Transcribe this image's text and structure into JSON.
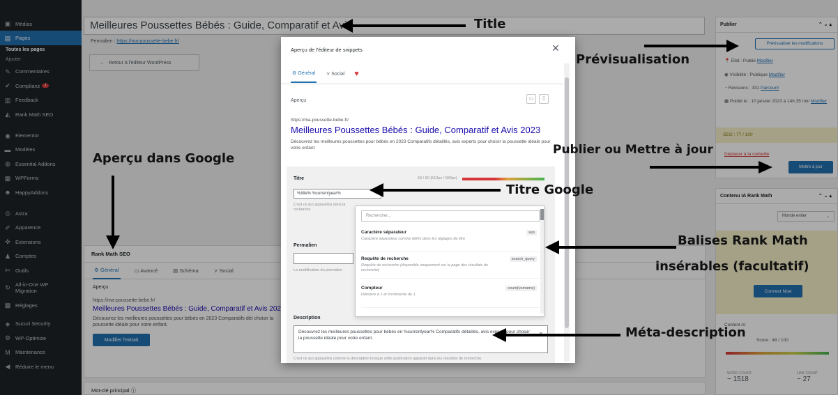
{
  "sidebar": {
    "items": [
      {
        "label": "Médias",
        "icon": "media-icon"
      },
      {
        "label": "Pages",
        "icon": "pages-icon"
      },
      {
        "label": "Toutes les pages"
      },
      {
        "label": "Ajouter"
      },
      {
        "label": "Commentaires",
        "icon": "comments-icon"
      },
      {
        "label": "Complianz",
        "icon": "complianz-icon",
        "badge": "1"
      },
      {
        "label": "Feedback",
        "icon": "feedback-icon"
      },
      {
        "label": "Rank Math SEO",
        "icon": "rankmath-icon"
      },
      {
        "label": "Elementor",
        "icon": "elementor-icon"
      },
      {
        "label": "Modèles",
        "icon": "templates-icon"
      },
      {
        "label": "Essential Addons",
        "icon": "addons-icon"
      },
      {
        "label": "WPForms",
        "icon": "wpforms-icon"
      },
      {
        "label": "HappyAddons",
        "icon": "happyaddons-icon"
      },
      {
        "label": "Astra",
        "icon": "astra-icon"
      },
      {
        "label": "Apparence",
        "icon": "appearance-icon"
      },
      {
        "label": "Extensions",
        "icon": "plugins-icon"
      },
      {
        "label": "Comptes",
        "icon": "users-icon"
      },
      {
        "label": "Outils",
        "icon": "tools-icon"
      },
      {
        "label": "All-in-One WP Migration",
        "icon": "migration-icon"
      },
      {
        "label": "Réglages",
        "icon": "settings-icon"
      },
      {
        "label": "Sucuri Security",
        "icon": "sucuri-icon"
      },
      {
        "label": "WP-Optimize",
        "icon": "optimize-icon"
      },
      {
        "label": "Maintenance",
        "icon": "maintenance-icon"
      },
      {
        "label": "Réduire le menu",
        "icon": "collapse-icon"
      }
    ]
  },
  "editor": {
    "title": "Meilleures Poussettes Bébés : Guide, Comparatif et Avis",
    "permalink_label": "Permalien :",
    "permalink_url": "https://ma-poussette-bebe.fr/",
    "back_button": "Retour à l'éditeur WordPress"
  },
  "rank_math_panel": {
    "title": "Rank Math SEO",
    "tabs": [
      "Général",
      "Avancé",
      "Schéma",
      "Social"
    ],
    "preview_label": "Aperçu",
    "url": "https://ma-poussette-bebe.fr/",
    "google_title": "Meilleures Poussettes Bébés : Guide, Comparatif et Avis 202",
    "google_desc": "Découvrez les meilleures poussettes pour bébés en 2023 Comparatifs dét choisir la poussette idéale pour votre enfant.",
    "edit_button": "Modifier l'extrait",
    "focus_keyword": "Mot-clé principal"
  },
  "publish_box": {
    "title": "Publier",
    "preview_button": "Prévisualiser les modifications",
    "status_label": "État :",
    "status_value": "Publié",
    "status_link": "Modifier",
    "visibility_label": "Visibilité :",
    "visibility_value": "Publique",
    "visibility_link": "Modifier",
    "revisions_label": "Révisions :",
    "revisions_value": "331",
    "revisions_link": "Parcourir",
    "published_label": "Publié le :",
    "published_value": "10 janvier 2023 à 14h 35 min",
    "published_link": "Modifier",
    "seo_score": "SEO : 77 / 100",
    "trash_link": "Déplacer à la corbeille",
    "update_button": "Mettre à jour"
  },
  "rm_content_box": {
    "title": "Contenu IA Rank Math",
    "select": "Monde entier",
    "connect_button": "Connect Now",
    "content_ai_label": "Content AI",
    "score": "Score : 48 / 100",
    "word_count_label": "WORD COUNT",
    "word_count": "~ 1518",
    "link_count_label": "LINK COUNT",
    "link_count": "~ 27"
  },
  "modal": {
    "title": "Aperçu de l'éditeur de snippets",
    "close": "×",
    "tabs": [
      "Général",
      "Social"
    ],
    "preview_label": "Aperçu",
    "url": "https://ma-poussette-bebe.fr/",
    "google_title": "Meilleures Poussettes Bébés : Guide, Comparatif et Avis 2023",
    "google_desc": "Découvrez les meilleures poussettes pour bébés en 2023 Comparatifs détaillés, avis experts pour choisir la poussette idéale pour votre enfant",
    "title_label": "Titre",
    "title_count": "60 / 60 (512px / 580px)",
    "title_value": "%title% %currentyear%",
    "title_help": "C'est ce qui apparaîtra dans la recherche",
    "permalink_label": "Permalien",
    "permalink_help": "La modification du permalien",
    "description_label": "Description",
    "description_value": "Découvrez les meilleures poussettes pour bébés en %currentyear% Comparatifs détaillés, avis experts pour choisir la poussette idéale pour votre enfant.",
    "description_help": "C'est ce qui apparaîtra comme la description lorsque cette publication apparaît dans les résultats de recherche."
  },
  "dropdown": {
    "search_placeholder": "Rechercher...",
    "items": [
      {
        "name": "Caractère séparateur",
        "key": "sep",
        "desc": "Caractère séparateur comme défini dans les réglages de titre"
      },
      {
        "name": "Requête de recherche",
        "key": "search_query",
        "desc": "Requête de recherche (disponible uniquement sur la page des résultats de recherche)"
      },
      {
        "name": "Compteur",
        "key": "count(varname)",
        "desc": "Démarre à 1 et incrémente de 1."
      }
    ]
  },
  "annotations": {
    "title": "Title",
    "preview": "Prévisualisation",
    "google_preview": "Aperçu dans Google",
    "publish": "Publier ou Mettre à jour",
    "google_title": "Titre Google",
    "tags_line1": "Balises Rank Math",
    "tags_line2": "insérables (facultatif)",
    "meta_description": "Méta-description"
  }
}
